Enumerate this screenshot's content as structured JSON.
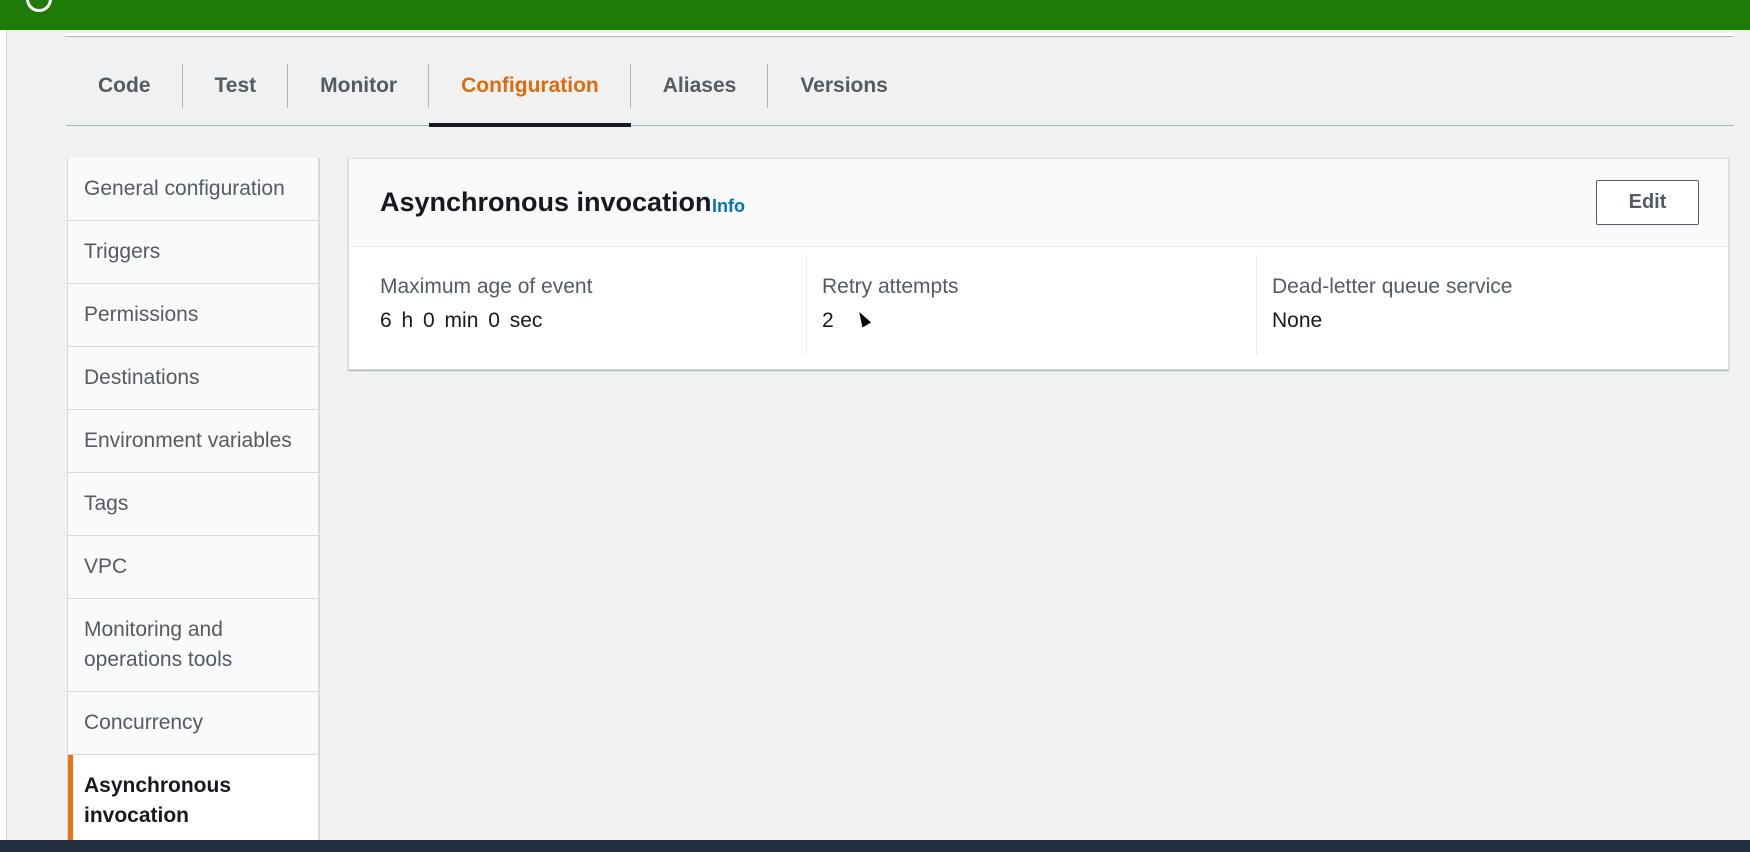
{
  "tabs": [
    {
      "label": "Code"
    },
    {
      "label": "Test"
    },
    {
      "label": "Monitor"
    },
    {
      "label": "Configuration"
    },
    {
      "label": "Aliases"
    },
    {
      "label": "Versions"
    }
  ],
  "active_tab": "Configuration",
  "sidebar": {
    "items": [
      {
        "label": "General configuration"
      },
      {
        "label": "Triggers"
      },
      {
        "label": "Permissions"
      },
      {
        "label": "Destinations"
      },
      {
        "label": "Environment variables"
      },
      {
        "label": "Tags"
      },
      {
        "label": "VPC"
      },
      {
        "label": "Monitoring and operations tools"
      },
      {
        "label": "Concurrency"
      },
      {
        "label": "Asynchronous invocation"
      }
    ],
    "active_item": "Asynchronous invocation"
  },
  "panel": {
    "title": "Asynchronous invocation",
    "info_label": "Info",
    "edit_label": "Edit",
    "fields": [
      {
        "label": "Maximum age of event",
        "value": "6 h  0 min  0 sec"
      },
      {
        "label": "Retry attempts",
        "value": "2"
      },
      {
        "label": "Dead-letter queue service",
        "value": "None"
      }
    ]
  },
  "colors": {
    "banner": "#1d7b06",
    "active_tab": "#dd6b10",
    "active_marker": "#ec7211",
    "link": "#0073bb"
  }
}
